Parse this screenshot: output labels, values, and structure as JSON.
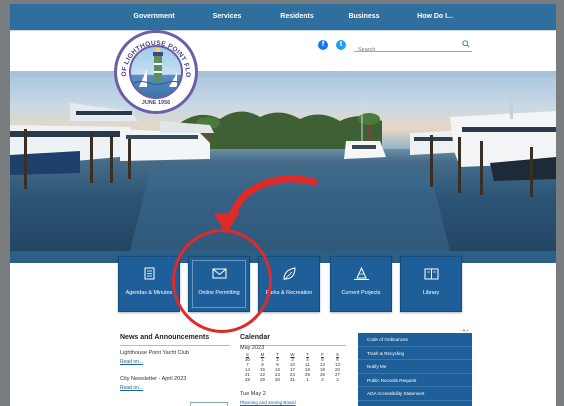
{
  "nav": {
    "items": [
      "Government",
      "Services",
      "Residents",
      "Business",
      "How Do I..."
    ]
  },
  "seal": {
    "ring_text": "CITY OF LIGHTHOUSE POINT FLORIDA",
    "date": "JUNE 1956"
  },
  "social": {
    "facebook_icon": "facebook-icon",
    "twitter_icon": "twitter-icon"
  },
  "search": {
    "placeholder": "Search",
    "icon": "search-icon"
  },
  "quick_tiles": [
    {
      "label": "Agendas & Minutes",
      "icon": "document-icon"
    },
    {
      "label": "Online Permitting",
      "icon": "envelope-icon"
    },
    {
      "label": "Parks & Recreation",
      "icon": "leaf-icon"
    },
    {
      "label": "Current Projects",
      "icon": "traffic-cone-icon"
    },
    {
      "label": "Library",
      "icon": "book-icon"
    }
  ],
  "news": {
    "title": "News and Announcements",
    "items": [
      {
        "headline": "Lighthouse Point Yacht Club",
        "link": "Read on..."
      },
      {
        "headline": "City Newsletter - April 2023",
        "link": "Read on..."
      }
    ]
  },
  "calendar": {
    "title": "Calendar",
    "month": "May 2023",
    "weekdays": [
      "S",
      "M",
      "T",
      "W",
      "T",
      "F",
      "S"
    ],
    "days": [
      "30",
      "1",
      "2",
      "3",
      "4",
      "5",
      "6",
      "7",
      "8",
      "9",
      "10",
      "11",
      "12",
      "13",
      "14",
      "15",
      "16",
      "17",
      "18",
      "19",
      "20",
      "21",
      "22",
      "23",
      "24",
      "25",
      "26",
      "27",
      "28",
      "29",
      "30",
      "31",
      "1",
      "2",
      "3"
    ],
    "event_date": "Tue May 2",
    "event_title": "Planning and Zoning Board"
  },
  "sidebar_links": [
    "Code of Ordinances",
    "Trash & Recycling",
    "Notify Me",
    "Public Records Request",
    "ADA Accessibility Statement"
  ],
  "text_resize": "- A +",
  "colors": {
    "nav_blue": "#2f6f9e",
    "tile_blue": "#1f5f99",
    "annotation_red": "#e02a2a"
  }
}
